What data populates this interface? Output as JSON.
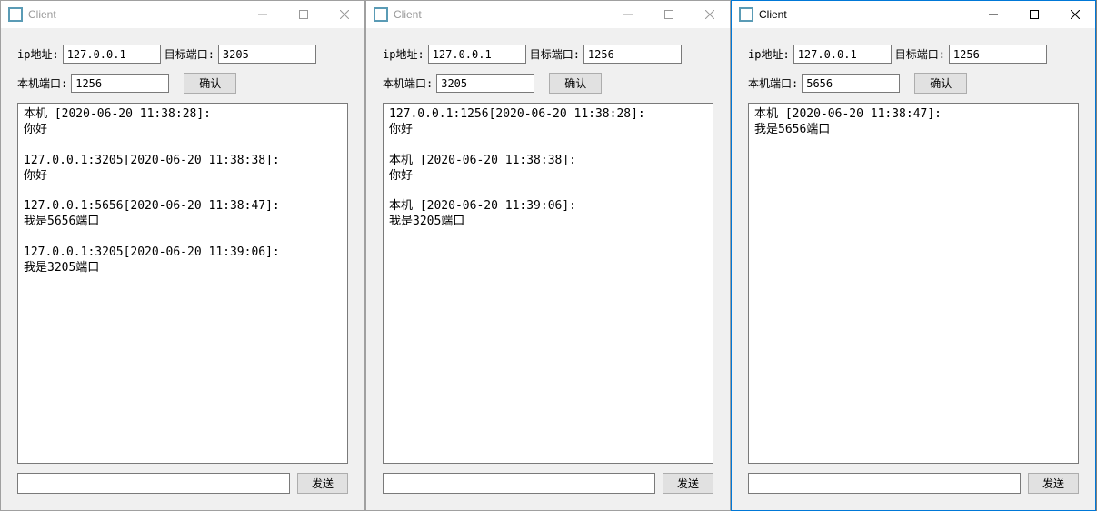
{
  "windows": [
    {
      "title": "Client",
      "active": false,
      "ip_label": "ip地址:",
      "ip_value": "127.0.0.1",
      "target_port_label": "目标端口:",
      "target_port_value": "3205",
      "local_port_label": "本机端口:",
      "local_port_value": "1256",
      "confirm_label": "确认",
      "log": "本机 [2020-06-20 11:38:28]:\n你好\n\n127.0.0.1:3205[2020-06-20 11:38:38]:\n你好\n\n127.0.0.1:5656[2020-06-20 11:38:47]:\n我是5656端口\n\n127.0.0.1:3205[2020-06-20 11:39:06]:\n我是3205端口",
      "msg_value": "",
      "send_label": "发送"
    },
    {
      "title": "Client",
      "active": false,
      "ip_label": "ip地址:",
      "ip_value": "127.0.0.1",
      "target_port_label": "目标端口:",
      "target_port_value": "1256",
      "local_port_label": "本机端口:",
      "local_port_value": "3205",
      "confirm_label": "确认",
      "log": "127.0.0.1:1256[2020-06-20 11:38:28]:\n你好\n\n本机 [2020-06-20 11:38:38]:\n你好\n\n本机 [2020-06-20 11:39:06]:\n我是3205端口",
      "msg_value": "",
      "send_label": "发送"
    },
    {
      "title": "Client",
      "active": true,
      "ip_label": "ip地址:",
      "ip_value": "127.0.0.1",
      "target_port_label": "目标端口:",
      "target_port_value": "1256",
      "local_port_label": "本机端口:",
      "local_port_value": "5656",
      "confirm_label": "确认",
      "log": "本机 [2020-06-20 11:38:47]:\n我是5656端口",
      "msg_value": "",
      "send_label": "发送"
    }
  ]
}
